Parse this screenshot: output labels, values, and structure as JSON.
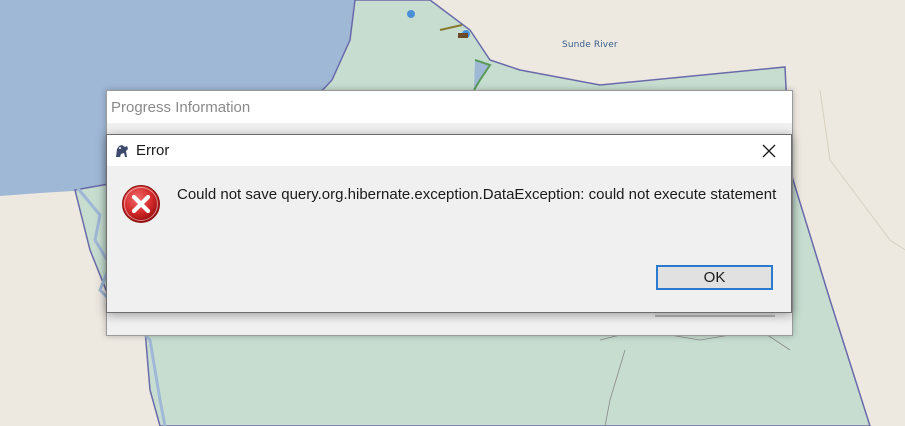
{
  "map": {
    "river_label": "Sunde River"
  },
  "progress_dialog": {
    "title": "Progress Information"
  },
  "error_dialog": {
    "title": "Error",
    "message": "Could not save query.org.hibernate.exception.DataException: could not execute statement",
    "ok_label": "OK",
    "icons": {
      "app": "app-logo-icon",
      "error": "error-x-icon",
      "close": "close-icon"
    }
  },
  "colors": {
    "water": "#9fb8d6",
    "land": "#ede9e1",
    "region_fill": "#c6ddd0",
    "region_border": "#6a6aaa",
    "ok_border": "#2a7bd0",
    "error_red": "#c8102e"
  }
}
